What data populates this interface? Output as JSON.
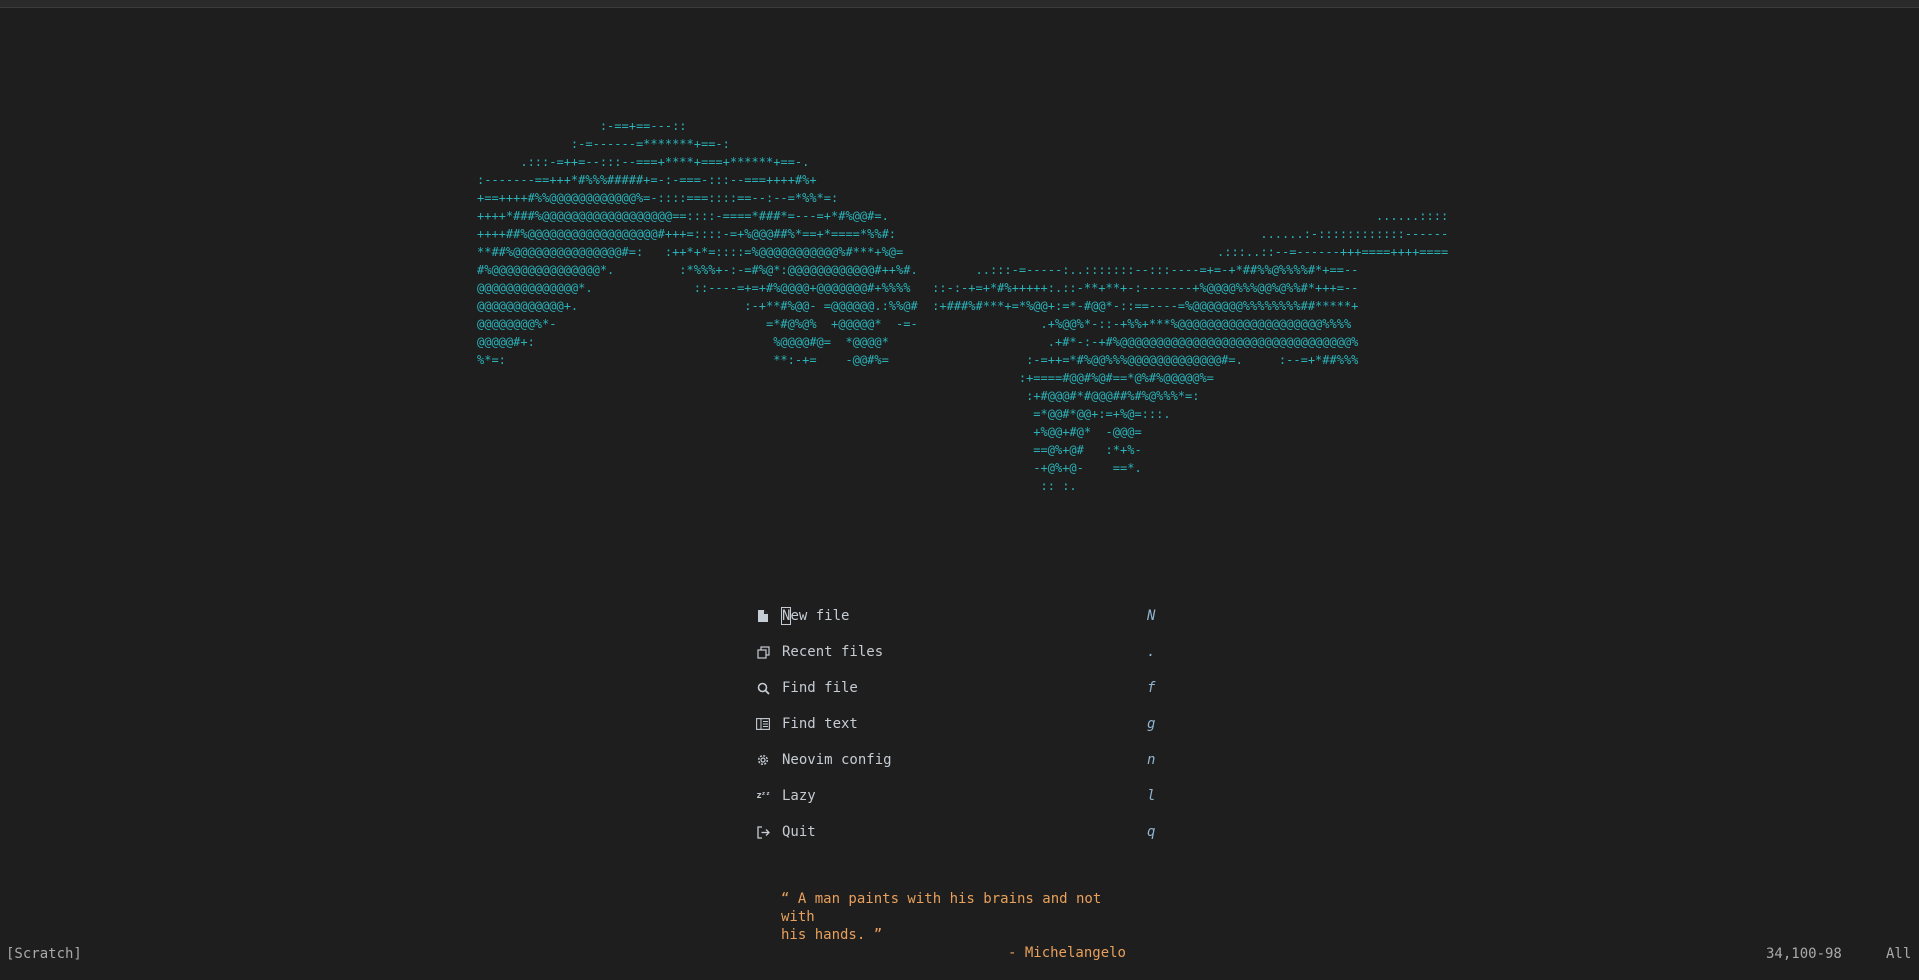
{
  "window": {
    "mode": "dashboard"
  },
  "header_art": {
    "lines": [
      "                 :-==+==---::",
      "             :-=------=*******+==-:",
      "      .:::-=++=--:::--===+****+===+******+==-.",
      ":-------==+++*#%%%#####+=-:-===-:::--===++++#%+",
      "+==++++#%%@@@@@@@@@@@@%=-::::===::::==--:--=*%%*=:",
      "++++*###%@@@@@@@@@@@@@@@@@@==::::-====*###*=---=+*#%@@#=.",
      "++++##%@@@@@@@@@@@@@@@@@@#+++=::::-=+%@@@##%*==+*====*%%#:",
      "**##%@@@@@@@@@@@@@@@#=:   :++*+*=::::=%@@@@@@@@@@@%#***+%@=",
      "#%@@@@@@@@@@@@@@@*.         :*%%%+-:-=#%@*:@@@@@@@@@@@@#++%#.        ..:::-=-----:..:::::::--:::----=+=-+*##%%@%%%%#*+==--",
      "@@@@@@@@@@@@@@*.              ::----=+=+#%@@@@+@@@@@@@#+%%%%   ::-:-+=+*#%+++++:.::-**+**+-:-------+%@@@@%%%@@%@%%#*+++=--",
      "@@@@@@@@@@@@+.                       :-+**#%@@- =@@@@@@.:%%@#  :+###%#***+=*%@@+:=*-#@@*-::==----=%@@@@@@@%%%%%%%%##*****+",
      "@@@@@@@@%*-                             =*#@%@%  +@@@@@*  -=-                 .+%@@%*-::-+%%+***%@@@@@@@@@@@@@@@@@@@@%%%%",
      "@@@@@#+:                                 %@@@@#@=  *@@@@*                      .+#*-:-+#%@@@@@@@@@@@@@@@@@@@@@@@@@@@@@@@@%",
      "%*=:                                     **:-+=    -@@#%=                   :-=++=*#%@@%%%@@@@@@@@@@@@@#=.     :--=+*##%%%",
      "                                                                           :+====#@@#%@#==*@%#%@@@@@%=",
      "                                                                            :+#@@@#*#@@@##%#%@%%%*=:",
      "                                                                             =*@@#*@@+:=+%@=:::.",
      "                                                                             +%@@+#@*  -@@@=",
      "                                                                             ==@%+@#   :*+%-",
      "                                                                             -+@%+@-    ==*.",
      "                                                                              :: :."
    ]
  },
  "header_art_right": {
    "lines": [
      "......::::",
      "......:-::::::::::::------",
      ".:::..::--=------+++====++++===="
    ]
  },
  "menu": {
    "items": [
      {
        "icon": "file-icon",
        "label_first": "N",
        "label_rest": "ew file",
        "key": "N"
      },
      {
        "icon": "copy-icon",
        "label": "Recent files",
        "key": "."
      },
      {
        "icon": "search-icon",
        "label": "Find file",
        "key": "f"
      },
      {
        "icon": "text-search-icon",
        "label": "Find text",
        "key": "g"
      },
      {
        "icon": "gear-icon",
        "label": "Neovim config",
        "key": "n"
      },
      {
        "icon": "sleep-icon",
        "label": "Lazy",
        "key": "l"
      },
      {
        "icon": "exit-icon",
        "label": "Quit",
        "key": "q"
      }
    ]
  },
  "quote": {
    "text_line1": "“ A man paints with his brains and not with",
    "text_line2": "his hands. ”",
    "author": "- Michelangelo"
  },
  "statusline": {
    "buffer": "[Scratch]",
    "position": "34,100-98",
    "scroll": "All"
  },
  "colors": {
    "background": "#1e1e1e",
    "art": "#2bb3ba",
    "menu_text": "#c6ccd3",
    "menu_key": "#8fb4cf",
    "quote": "#e8a05b",
    "status": "#a9a9a9"
  }
}
